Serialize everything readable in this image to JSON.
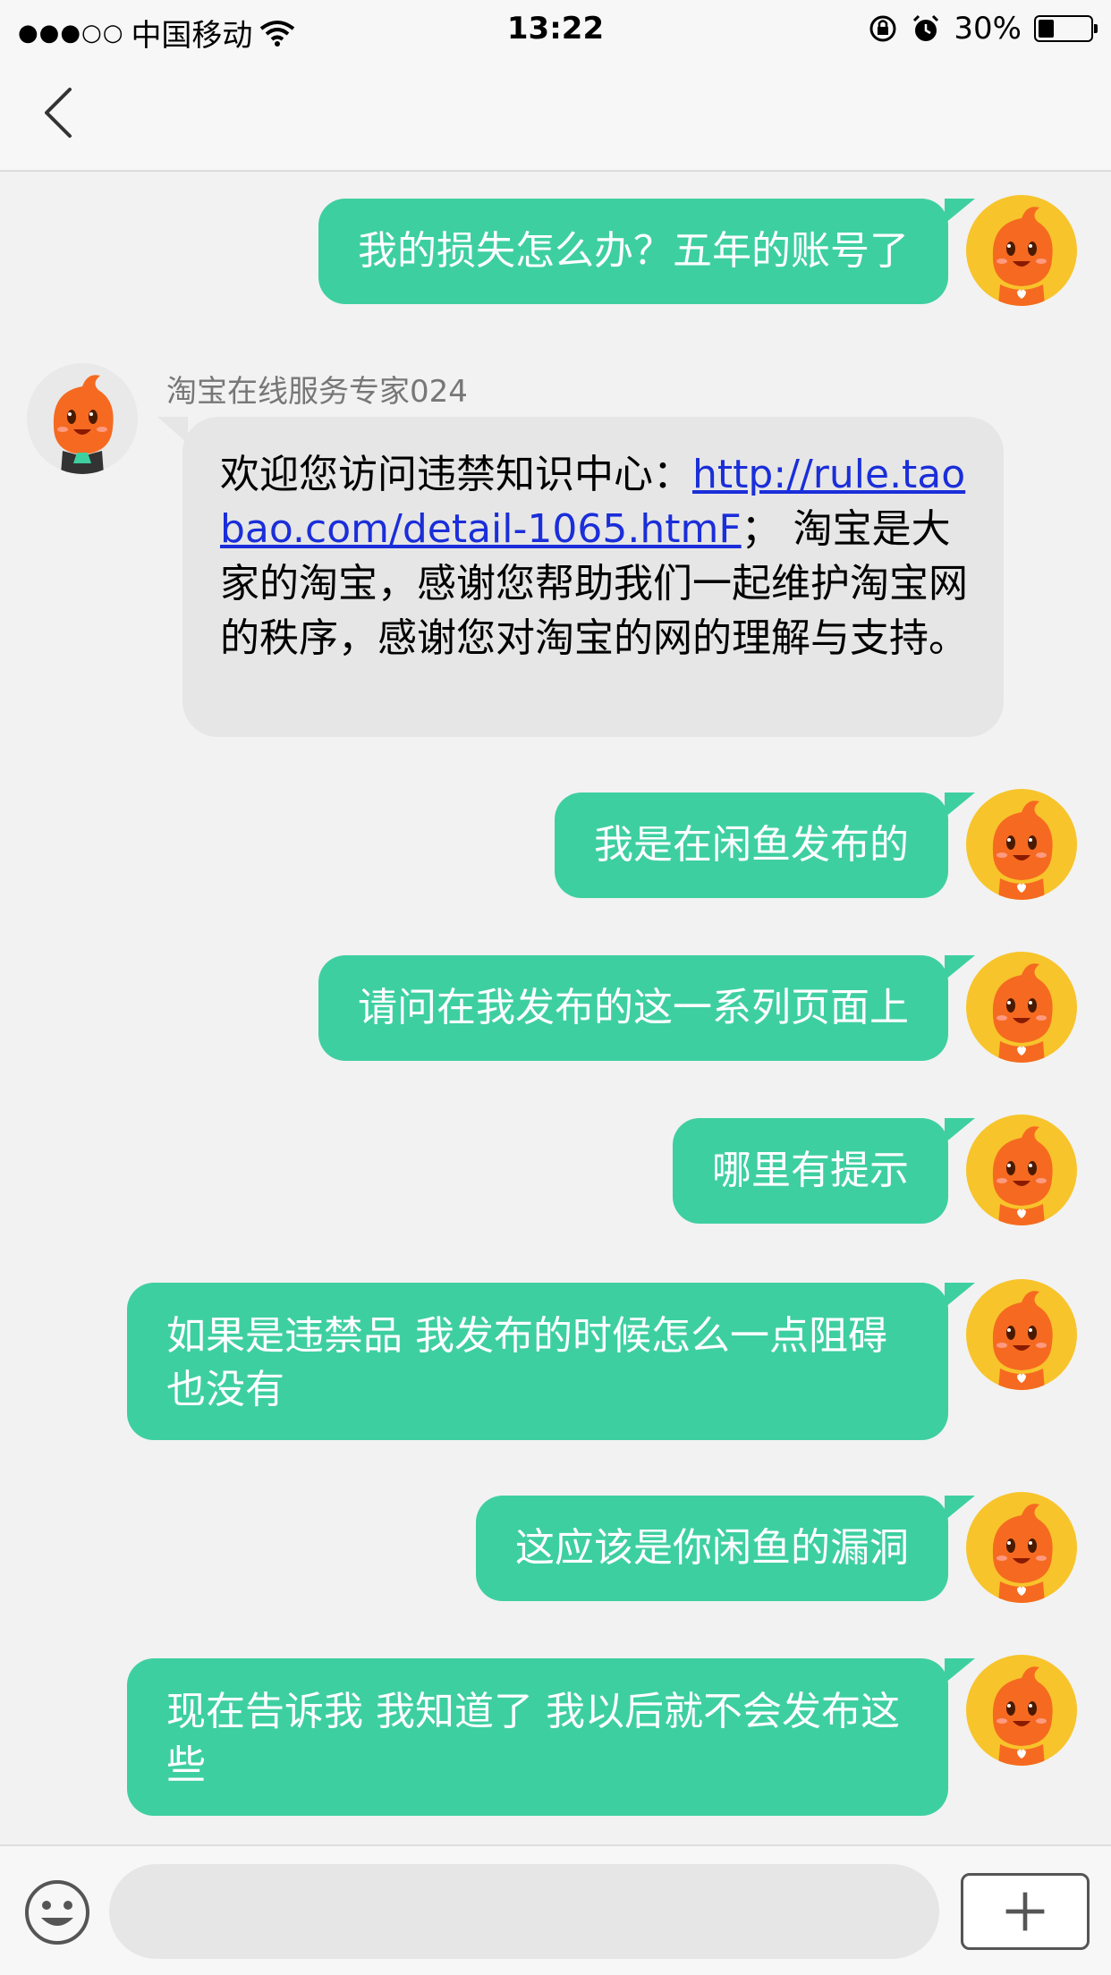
{
  "status_bar": {
    "carrier": "中国移动",
    "time": "13:22",
    "battery": "30%",
    "battery_fraction": 0.3
  },
  "messages": [
    {
      "type": "out",
      "text": "我的损失怎么办？五年的账号了"
    },
    {
      "type": "in",
      "sender": "淘宝在线服务专家024",
      "text_before": "欢迎您访问违禁知识中心：",
      "link": "http://rule.taobao.com/detail-1065.htmF",
      "text_after": "； 淘宝是大家的淘宝，感谢您帮助我们一起维护淘宝网的秩序，感谢您对淘宝的网的理解与支持。"
    },
    {
      "type": "out",
      "text": "我是在闲鱼发布的"
    },
    {
      "type": "out",
      "text": "请问在我发布的这一系列页面上"
    },
    {
      "type": "out",
      "text": "哪里有提示"
    },
    {
      "type": "out",
      "text": "如果是违禁品 我发布的时候怎么一点阻碍也没有"
    },
    {
      "type": "out",
      "text": "这应该是你闲鱼的漏洞"
    },
    {
      "type": "out",
      "text": "现在告诉我 我知道了 我以后就不会发布这些"
    }
  ],
  "input": {
    "value": "",
    "placeholder": ""
  }
}
